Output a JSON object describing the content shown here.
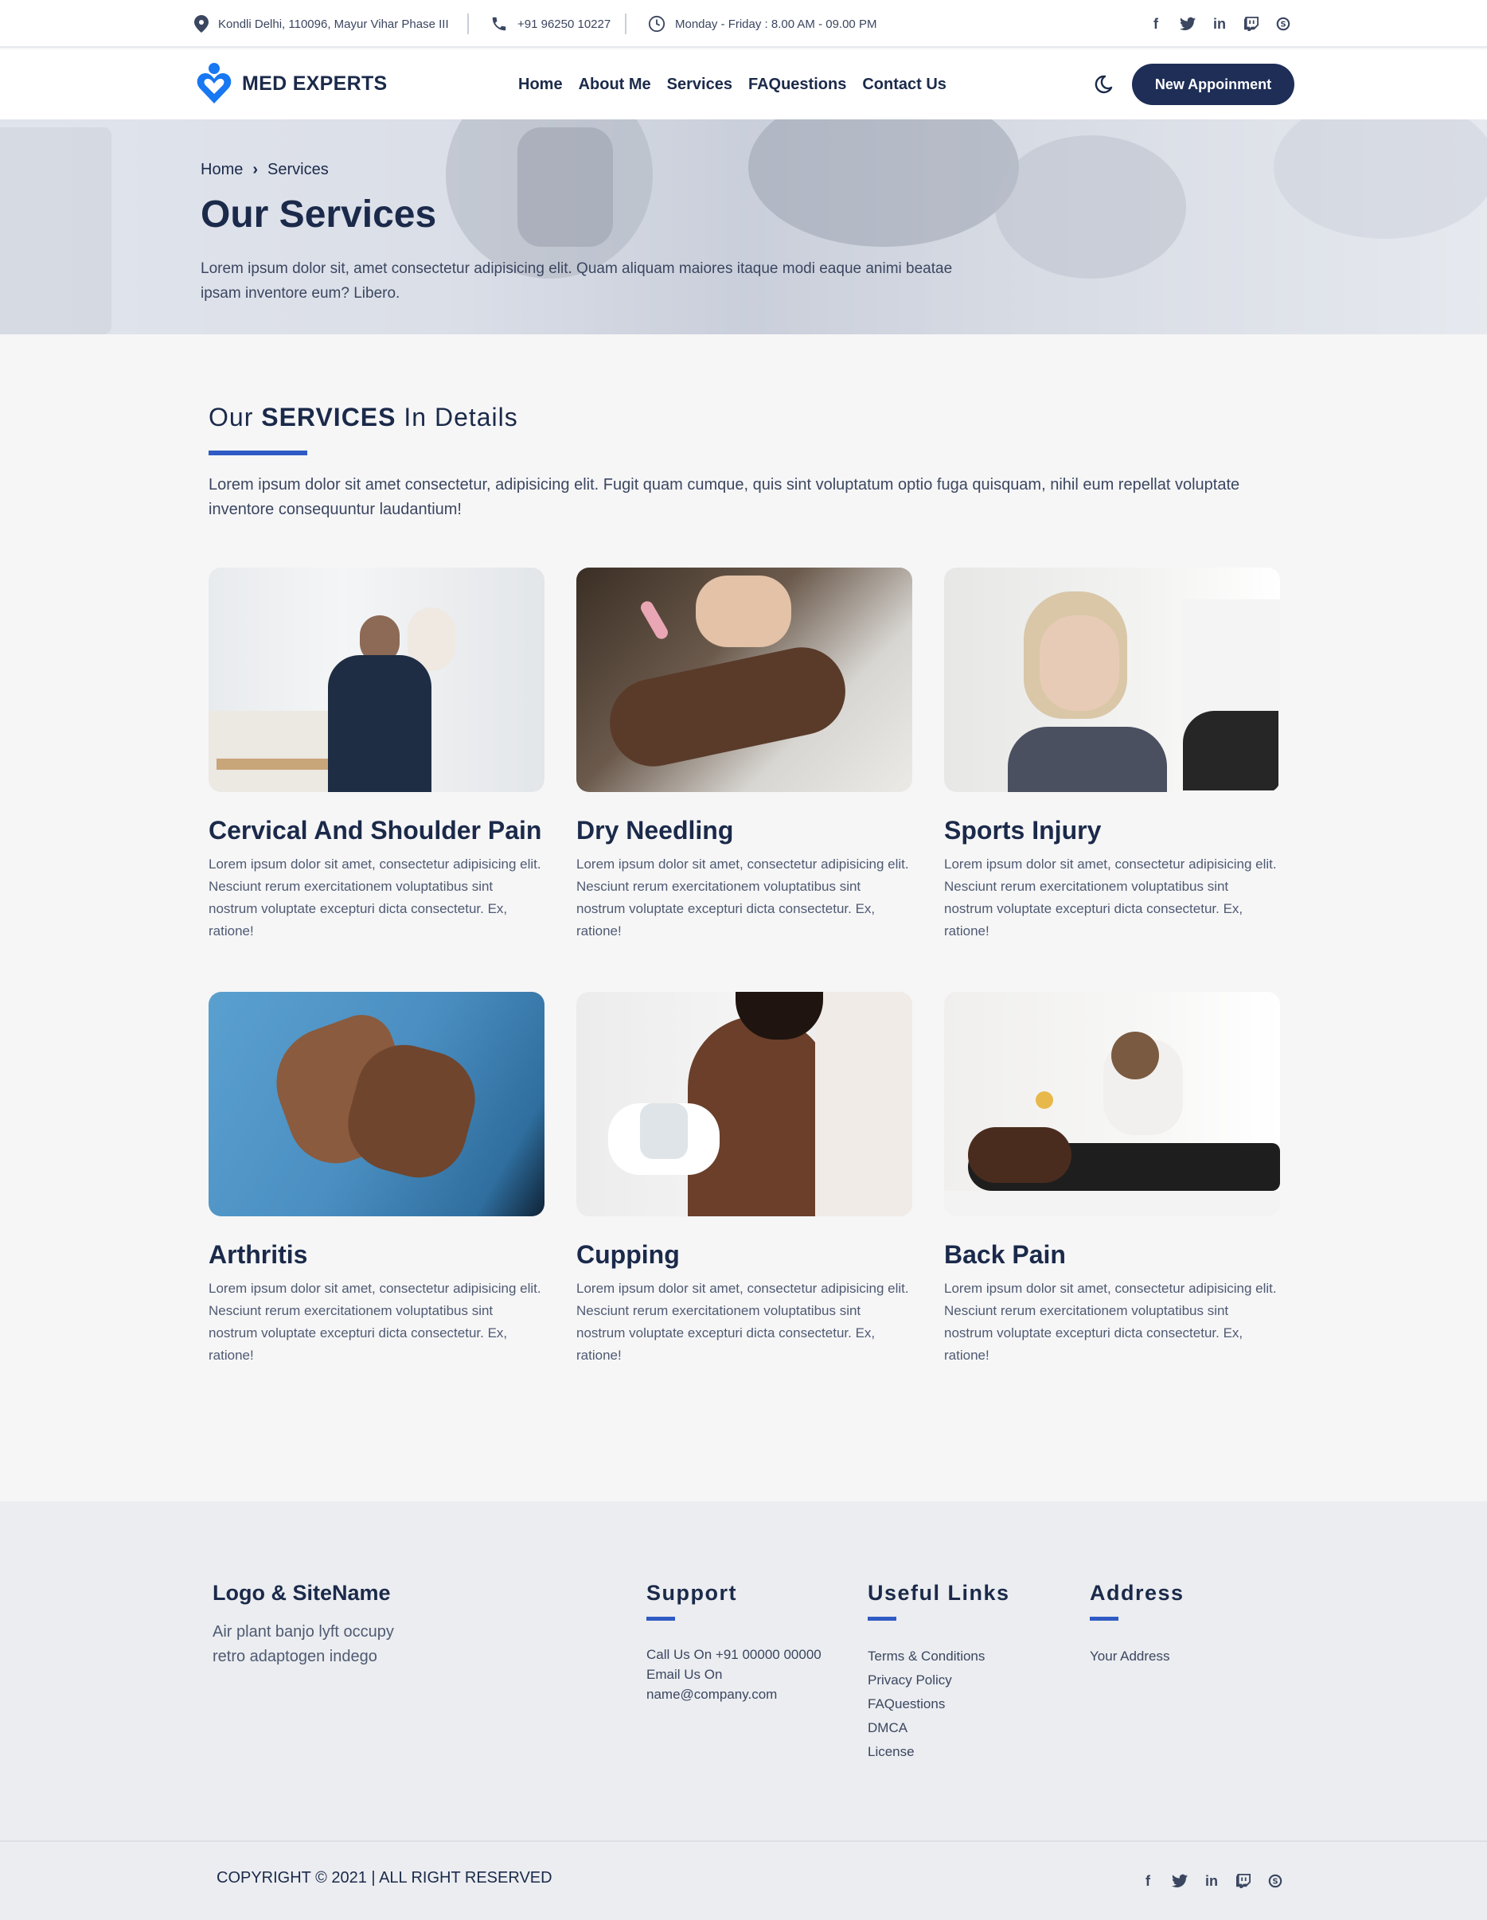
{
  "topbar": {
    "address": "Kondli Delhi, 110096, Mayur Vihar Phase III",
    "phone": "+91 96250 10227",
    "hours": "Monday - Friday : 8.00 AM - 09.00 PM",
    "social_icons": [
      "facebook-icon",
      "twitter-icon",
      "linkedin-icon",
      "twitch-icon",
      "skype-icon"
    ]
  },
  "nav": {
    "logo_text": "MED EXPERTS",
    "links": [
      "Home",
      "About Me",
      "Services",
      "FAQuestions",
      "Contact Us"
    ],
    "cta": "New Appoinment"
  },
  "hero": {
    "breadcrumb": [
      "Home",
      "Services"
    ],
    "title": "Our Services",
    "text": "Lorem ipsum dolor sit, amet consectetur adipisicing elit. Quam aliquam maiores itaque modi eaque animi beatae ipsam inventore eum? Libero."
  },
  "services": {
    "title_pre": "Our ",
    "title_bold": "SERVICES",
    "title_post": " In Details",
    "description": "Lorem ipsum dolor sit amet consectetur, adipisicing elit. Fugit quam cumque, quis sint voluptatum optio fuga quisquam, nihil eum repellat voluptate inventore consequuntur laudantium!",
    "items": [
      {
        "title": "Cervical And Shoulder Pain",
        "text": "Lorem ipsum dolor sit amet, consectetur adipisicing elit. Nesciunt rerum exercitationem voluptatibus sint nostrum voluptate excepturi dicta consectetur. Ex, ratione!"
      },
      {
        "title": "Dry Needling",
        "text": "Lorem ipsum dolor sit amet, consectetur adipisicing elit. Nesciunt rerum exercitationem voluptatibus sint nostrum voluptate excepturi dicta consectetur. Ex, ratione!"
      },
      {
        "title": "Sports Injury",
        "text": "Lorem ipsum dolor sit amet, consectetur adipisicing elit. Nesciunt rerum exercitationem voluptatibus sint nostrum voluptate excepturi dicta consectetur. Ex, ratione!"
      },
      {
        "title": "Arthritis",
        "text": "Lorem ipsum dolor sit amet, consectetur adipisicing elit. Nesciunt rerum exercitationem voluptatibus sint nostrum voluptate excepturi dicta consectetur. Ex, ratione!"
      },
      {
        "title": "Cupping",
        "text": "Lorem ipsum dolor sit amet, consectetur adipisicing elit. Nesciunt rerum exercitationem voluptatibus sint nostrum voluptate excepturi dicta consectetur. Ex, ratione!"
      },
      {
        "title": "Back Pain",
        "text": "Lorem ipsum dolor sit amet, consectetur adipisicing elit. Nesciunt rerum exercitationem voluptatibus sint nostrum voluptate excepturi dicta consectetur. Ex, ratione!"
      }
    ]
  },
  "footer": {
    "logo_title": "Logo & SiteName",
    "logo_text": "Air plant banjo lyft occupy retro adaptogen indego",
    "support": {
      "heading": "Support",
      "call": "Call Us On +91 00000 00000",
      "email_label": "Email Us On",
      "email": "name@company.com"
    },
    "useful": {
      "heading": "Useful Links",
      "links": [
        "Terms & Conditions",
        "Privacy Policy",
        "FAQuestions",
        "DMCA",
        "License"
      ]
    },
    "address": {
      "heading": "Address",
      "text": "Your Address"
    },
    "copyright": "COPYRIGHT © 2021 | ALL RIGHT RESERVED"
  },
  "colors": {
    "navy": "#1e2e57",
    "accent": "#2f5bc4",
    "brand_logo": "#1877f2"
  }
}
